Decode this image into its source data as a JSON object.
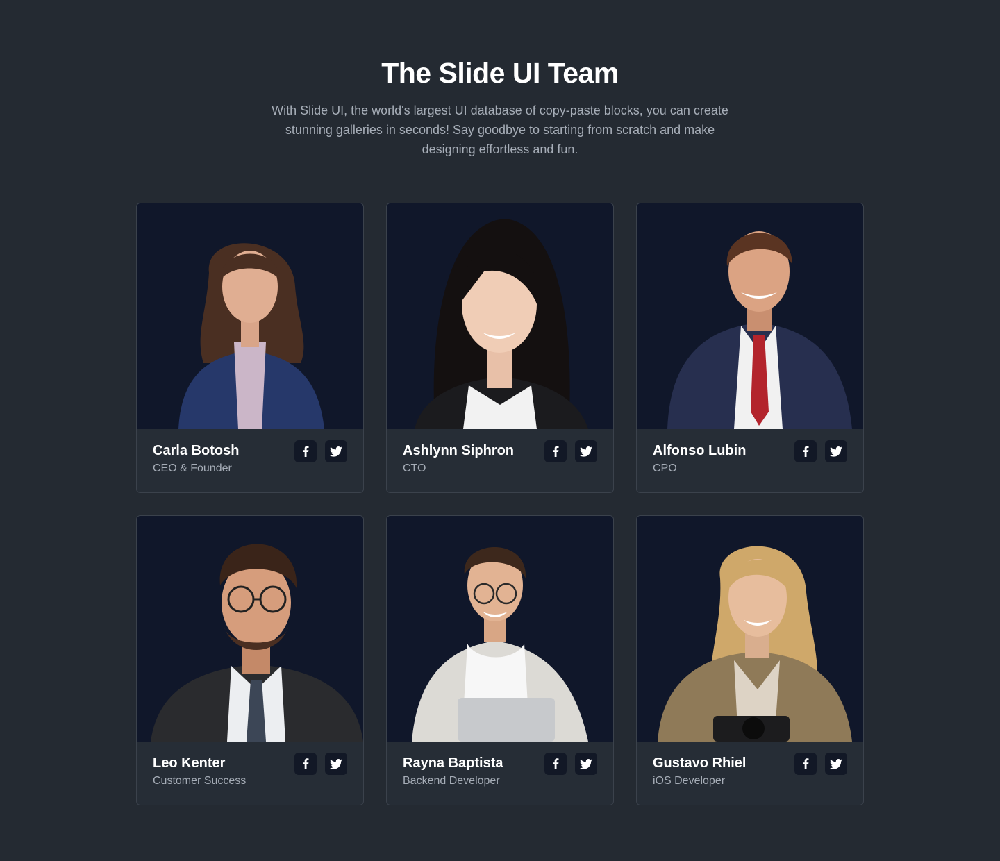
{
  "header": {
    "title": "The Slide UI Team",
    "subtitle": "With Slide UI, the world's largest UI database of copy-paste blocks, you can create stunning galleries in seconds! Say goodbye to starting from scratch and make designing effortless and fun."
  },
  "colors": {
    "page_background": "#242a32",
    "card_background": "#262d36",
    "photo_background": "#10172a",
    "icon_button_background": "#121826",
    "muted_text": "#a6adb7"
  },
  "team": [
    {
      "name": "Carla Botosh",
      "role": "CEO & Founder",
      "photo_icon": "woman-portrait-photo"
    },
    {
      "name": "Ashlynn Siphron",
      "role": "CTO",
      "photo_icon": "woman-portrait-photo"
    },
    {
      "name": "Alfonso Lubin",
      "role": "CPO",
      "photo_icon": "man-portrait-photo"
    },
    {
      "name": "Leo Kenter",
      "role": "Customer Success",
      "photo_icon": "man-portrait-photo"
    },
    {
      "name": "Rayna Baptista",
      "role": "Backend Developer",
      "photo_icon": "man-portrait-photo"
    },
    {
      "name": "Gustavo Rhiel",
      "role": "iOS Developer",
      "photo_icon": "woman-portrait-photo"
    }
  ],
  "social_icons": [
    "facebook-icon",
    "twitter-icon"
  ]
}
